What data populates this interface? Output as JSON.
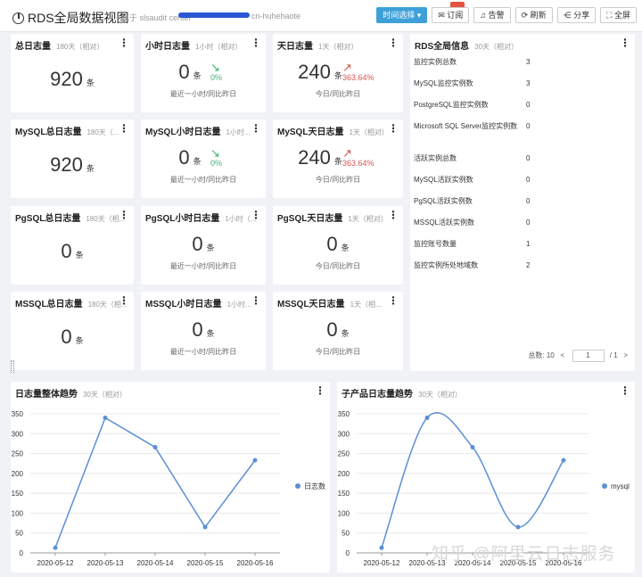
{
  "header": {
    "title": "RDS全局数据视图",
    "subtitle_prefix": "属于 slsaudit center",
    "subtitle_suffix": "cn-huhehaote"
  },
  "toolbar": {
    "time": "时间选择 ▾",
    "subscribe": "订阅",
    "alert": "告警",
    "refresh": "刷新",
    "share": "分享",
    "fullscreen": "全屏"
  },
  "unit": "条",
  "cards": [
    {
      "title": "总日志量",
      "scope": "180天（相对）",
      "value": "920"
    },
    {
      "title": "小时日志量",
      "scope": "1小时（相对）",
      "value": "0",
      "pct": "0%",
      "trend": "down",
      "compare": "最近一小时/同比昨日"
    },
    {
      "title": "天日志量",
      "scope": "1天（相对）",
      "value": "240",
      "pct": "363.64%",
      "trend": "up",
      "compare": "今日/同比昨日"
    },
    {
      "title": "MySQL总日志量",
      "scope": "180天（...",
      "value": "920"
    },
    {
      "title": "MySQL小时日志量",
      "scope": "1小时...",
      "value": "0",
      "pct": "0%",
      "trend": "down",
      "compare": "最近一小时/同比昨日"
    },
    {
      "title": "MySQL天日志量",
      "scope": "1天（相对）",
      "value": "240",
      "pct": "363.64%",
      "trend": "up",
      "compare": "今日/同比昨日"
    },
    {
      "title": "PgSQL总日志量",
      "scope": "180天（相...",
      "value": "0"
    },
    {
      "title": "PgSQL小时日志量",
      "scope": "1小时（...",
      "value": "0",
      "compare": "最近一小时/同比昨日"
    },
    {
      "title": "PgSQL天日志量",
      "scope": "1天（相对）",
      "value": "0",
      "compare": "今日/同比昨日"
    },
    {
      "title": "MSSQL总日志量",
      "scope": "180天（相...",
      "value": "0"
    },
    {
      "title": "MSSQL小时日志量",
      "scope": "1小时...",
      "value": "0",
      "compare": "最近一小时/同比昨日"
    },
    {
      "title": "MSSQL天日志量",
      "scope": "1天（相...",
      "value": "0",
      "compare": "今日/同比昨日"
    }
  ],
  "rds_info": {
    "title": "RDS全局信息",
    "scope": "30天（相对）",
    "rows": [
      {
        "k": "监控实例总数",
        "v": "3"
      },
      {
        "k": "MySQL监控实例数",
        "v": "3"
      },
      {
        "k": "PostgreSQL监控实例数",
        "v": "0"
      },
      {
        "k": "Microsoft SQL Server监控实例数",
        "v": "0"
      },
      {
        "k": "活跃实例总数",
        "v": "0"
      },
      {
        "k": "MySQL活跃实例数",
        "v": "0"
      },
      {
        "k": "PgSQL活跃实例数",
        "v": "0"
      },
      {
        "k": "MSSQL活跃实例数",
        "v": "0"
      },
      {
        "k": "监控账号数量",
        "v": "1"
      },
      {
        "k": "监控实例所处地域数",
        "v": "2"
      }
    ],
    "pager": {
      "total_label": "总数:",
      "total": "10",
      "prev": "<",
      "page": "1",
      "of": "/ 1",
      "next": ">"
    }
  },
  "chart_left_title": "日志量整体趋势",
  "chart_left_scope": "30天（相对）",
  "chart_right_title": "子产品日志量趋势",
  "chart_right_scope": "30天（相对）",
  "watermark": "知乎 @阿里云日志服务",
  "chart_data": [
    {
      "type": "line",
      "categories": [
        "2020-05-12",
        "2020-05-13",
        "2020-05-14",
        "2020-05-15",
        "2020-05-16"
      ],
      "series": [
        {
          "name": "日志数",
          "values": [
            13,
            340,
            266,
            65,
            233
          ]
        }
      ],
      "ylim": [
        0,
        350
      ],
      "yticks": [
        0,
        50,
        100,
        150,
        200,
        250,
        300,
        350
      ],
      "color": "#5b8fd6",
      "smooth": false,
      "legend": "right"
    },
    {
      "type": "line",
      "categories": [
        "2020-05-12",
        "2020-05-13",
        "2020-05-14",
        "2020-05-15",
        "2020-05-16"
      ],
      "series": [
        {
          "name": "mysql",
          "values": [
            13,
            340,
            266,
            65,
            233
          ]
        }
      ],
      "ylim": [
        0,
        350
      ],
      "yticks": [
        0,
        50,
        100,
        150,
        200,
        250,
        300,
        350
      ],
      "color": "#5b8fd6",
      "smooth": true,
      "legend": "right"
    }
  ]
}
